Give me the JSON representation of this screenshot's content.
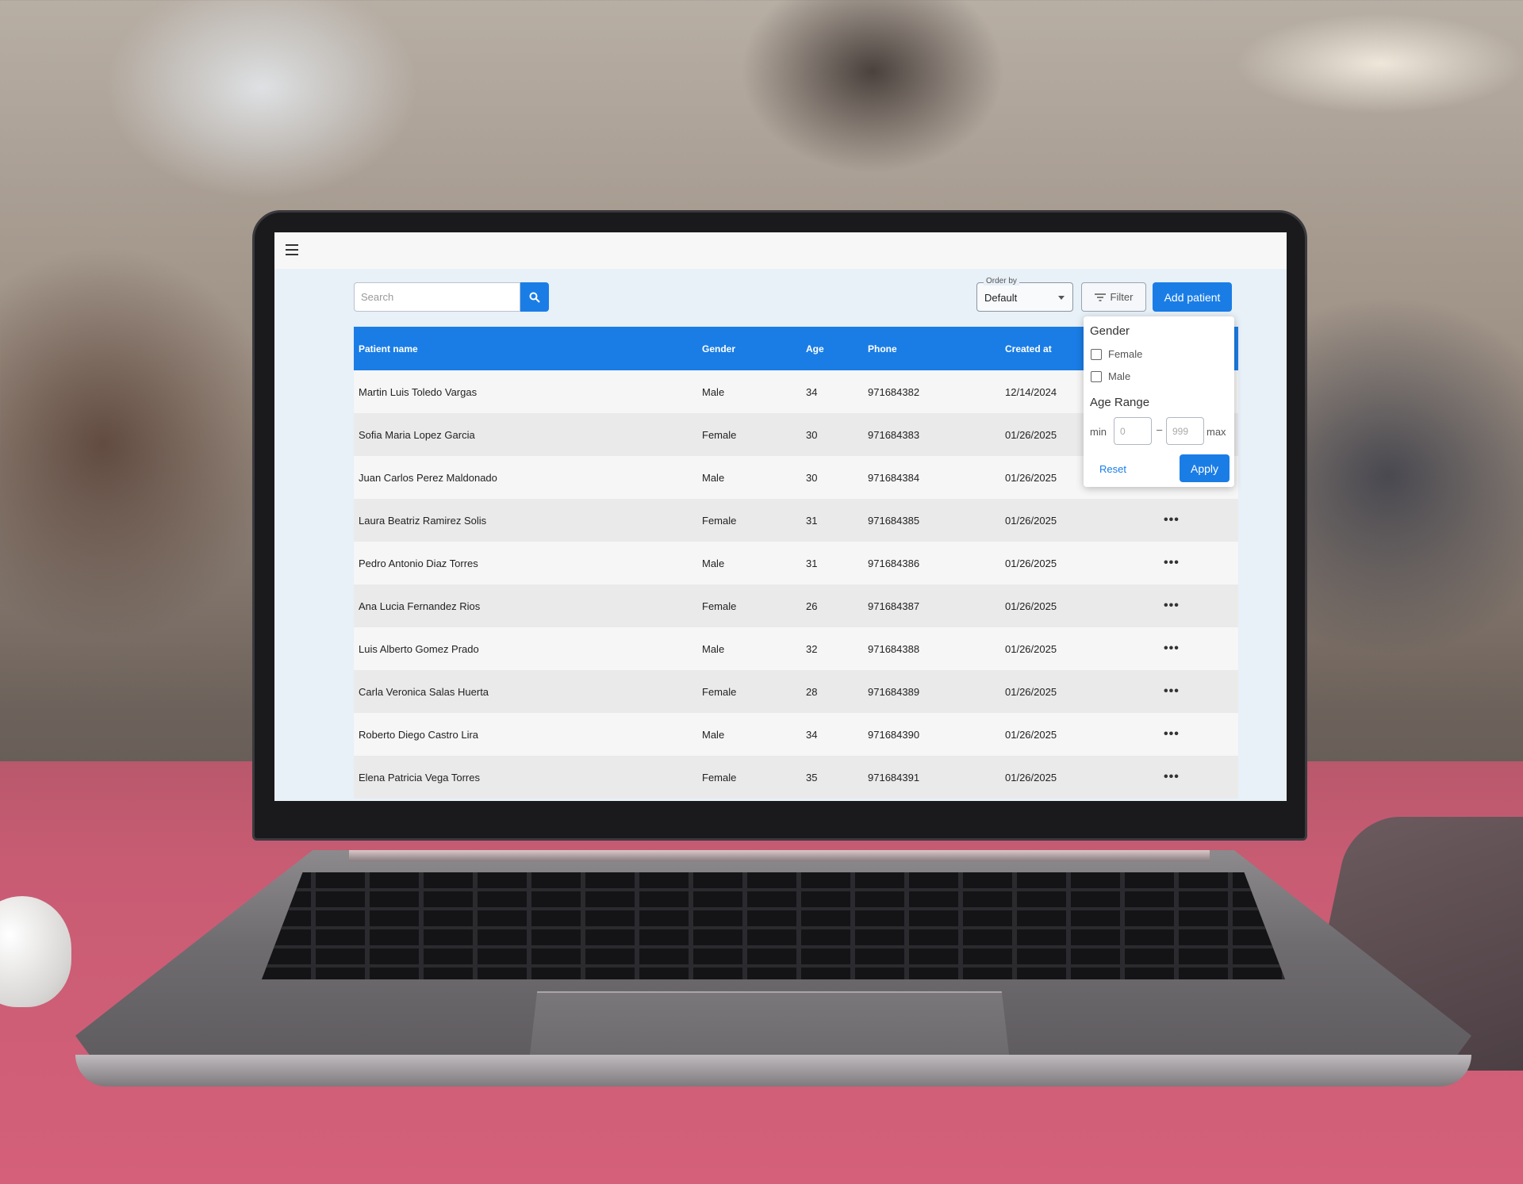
{
  "toolbar": {
    "search_placeholder": "Search",
    "order_by_label": "Order by",
    "order_by_value": "Default",
    "filter_label": "Filter",
    "add_patient_label": "Add patient"
  },
  "table": {
    "headers": [
      "Patient name",
      "Gender",
      "Age",
      "Phone",
      "Created at"
    ],
    "rows": [
      {
        "name": "Martin Luis Toledo Vargas",
        "gender": "Male",
        "age": "34",
        "phone": "971684382",
        "created": "12/14/2024",
        "actions": "•••"
      },
      {
        "name": "Sofia Maria Lopez Garcia",
        "gender": "Female",
        "age": "30",
        "phone": "971684383",
        "created": "01/26/2025",
        "actions": "•••"
      },
      {
        "name": "Juan Carlos Perez Maldonado",
        "gender": "Male",
        "age": "30",
        "phone": "971684384",
        "created": "01/26/2025",
        "actions": "•••"
      },
      {
        "name": "Laura Beatriz Ramirez Solis",
        "gender": "Female",
        "age": "31",
        "phone": "971684385",
        "created": "01/26/2025",
        "actions": "•••"
      },
      {
        "name": "Pedro Antonio Diaz Torres",
        "gender": "Male",
        "age": "31",
        "phone": "971684386",
        "created": "01/26/2025",
        "actions": "•••"
      },
      {
        "name": "Ana Lucia Fernandez Rios",
        "gender": "Female",
        "age": "26",
        "phone": "971684387",
        "created": "01/26/2025",
        "actions": "•••"
      },
      {
        "name": "Luis Alberto Gomez Prado",
        "gender": "Male",
        "age": "32",
        "phone": "971684388",
        "created": "01/26/2025",
        "actions": "•••"
      },
      {
        "name": "Carla Veronica Salas Huerta",
        "gender": "Female",
        "age": "28",
        "phone": "971684389",
        "created": "01/26/2025",
        "actions": "•••"
      },
      {
        "name": "Roberto Diego Castro Lira",
        "gender": "Male",
        "age": "34",
        "phone": "971684390",
        "created": "01/26/2025",
        "actions": "•••"
      },
      {
        "name": "Elena Patricia Vega Torres",
        "gender": "Female",
        "age": "35",
        "phone": "971684391",
        "created": "01/26/2025",
        "actions": "•••"
      }
    ]
  },
  "filter_panel": {
    "gender_title": "Gender",
    "option_female": "Female",
    "option_male": "Male",
    "age_range_title": "Age Range",
    "min_label": "min",
    "max_label": "max",
    "min_placeholder": "0",
    "max_placeholder": "999",
    "dash": "–",
    "reset_label": "Reset",
    "apply_label": "Apply"
  },
  "colors": {
    "accent": "#1a7de6",
    "screen_bg": "#e8f0f8"
  },
  "icons": [
    "menu-icon",
    "search-icon",
    "filter-icon",
    "chevron-down-icon",
    "more-icon"
  ]
}
